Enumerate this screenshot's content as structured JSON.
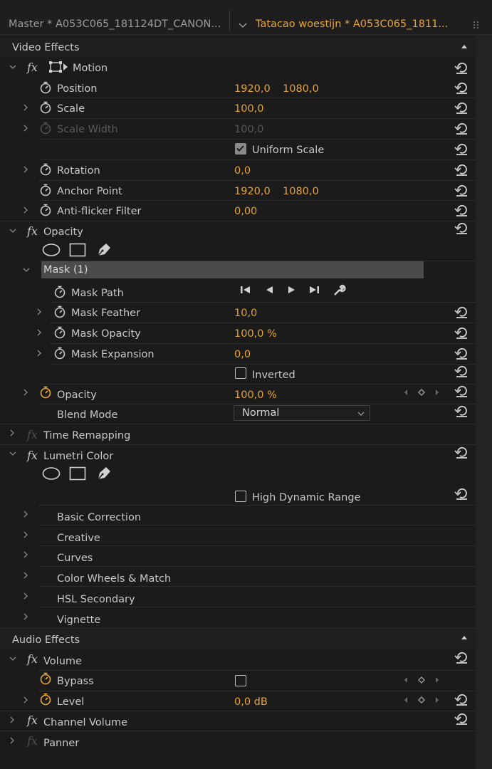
{
  "header": {
    "master_label": "Master * A053C065_181124DT_CANON...",
    "clip_label": "Tatacao woestijn * A053C065_1811..."
  },
  "video_effects": {
    "title": "Video Effects",
    "motion": {
      "title": "Motion",
      "position": {
        "label": "Position",
        "x": "1920,0",
        "y": "1080,0"
      },
      "scale": {
        "label": "Scale",
        "value": "100,0"
      },
      "scale_width": {
        "label": "Scale Width",
        "value": "100,0"
      },
      "uniform_scale": {
        "label": "Uniform Scale",
        "checked": true
      },
      "rotation": {
        "label": "Rotation",
        "value": "0,0"
      },
      "anchor_point": {
        "label": "Anchor Point",
        "x": "1920,0",
        "y": "1080,0"
      },
      "anti_flicker": {
        "label": "Anti-flicker Filter",
        "value": "0,00"
      }
    },
    "opacity": {
      "title": "Opacity",
      "mask": {
        "title": "Mask (1)",
        "path_label": "Mask Path",
        "feather": {
          "label": "Mask Feather",
          "value": "10,0"
        },
        "opacity": {
          "label": "Mask Opacity",
          "value": "100,0 %"
        },
        "expansion": {
          "label": "Mask Expansion",
          "value": "0,0"
        },
        "inverted": {
          "label": "Inverted",
          "checked": false
        }
      },
      "opacity_prop": {
        "label": "Opacity",
        "value": "100,0 %"
      },
      "blend_mode": {
        "label": "Blend Mode",
        "value": "Normal"
      }
    },
    "time_remapping": {
      "title": "Time Remapping"
    },
    "lumetri": {
      "title": "Lumetri Color",
      "hdr": {
        "label": "High Dynamic Range",
        "checked": false
      },
      "sections": [
        "Basic Correction",
        "Creative",
        "Curves",
        "Color Wheels & Match",
        "HSL Secondary",
        "Vignette"
      ]
    }
  },
  "audio_effects": {
    "title": "Audio Effects",
    "volume": {
      "title": "Volume",
      "bypass": {
        "label": "Bypass",
        "checked": false
      },
      "level": {
        "label": "Level",
        "value": "0,0 dB"
      }
    },
    "channel_volume": {
      "title": "Channel Volume"
    },
    "panner": {
      "title": "Panner"
    }
  },
  "colors": {
    "accent": "#e8a435",
    "panel": "#1b1b1b",
    "text": "#c8c8c8",
    "dim": "#595959"
  }
}
